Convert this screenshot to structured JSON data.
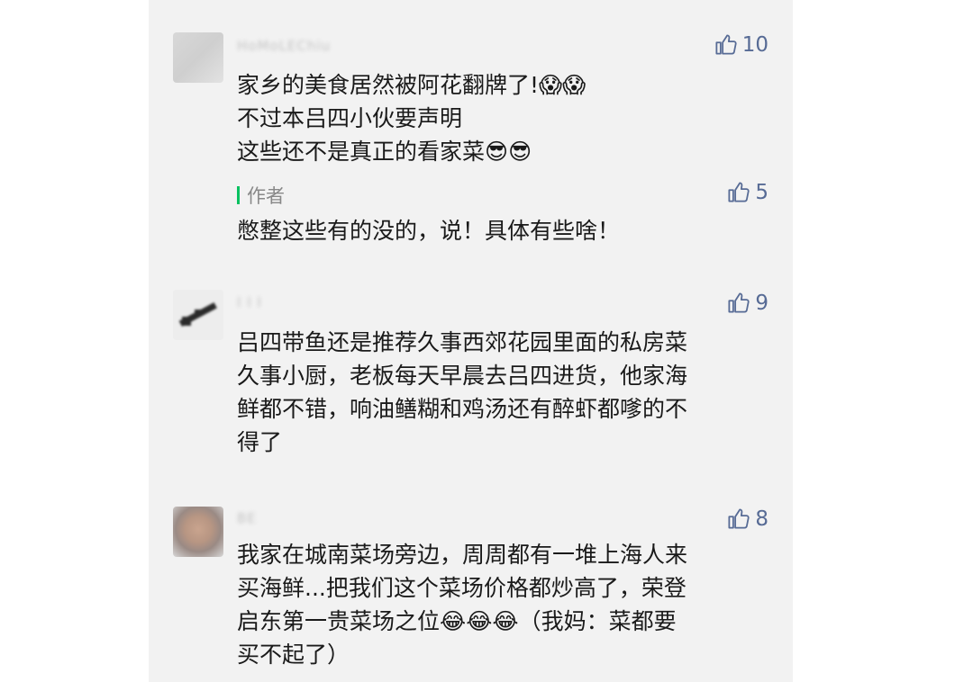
{
  "comments": [
    {
      "nickname": "HoMoLEChiu",
      "likes": "10",
      "lines": [
        "家乡的美食居然被阿花翻牌了!😱😱",
        "不过本吕四小伙要声明",
        "这些还不是真正的看家菜😎😎"
      ],
      "reply": {
        "tag": "作者",
        "likes": "5",
        "text": "憋整这些有的没的，说！具体有些啥！"
      }
    },
    {
      "nickname": "I I I",
      "likes": "9",
      "lines": [
        "吕四带鱼还是推荐久事西郊花园里面的私房菜",
        "久事小厨，老板每天早晨去吕四进货，他家海",
        "鲜都不错，响油鳝糊和鸡汤还有醉虾都嗲的不",
        "得了"
      ]
    },
    {
      "nickname": "BE",
      "likes": "8",
      "lines": [
        "我家在城南菜场旁边，周周都有一堆上海人来",
        "买海鲜...把我们这个菜场价格都炒高了，荣登",
        "启东第一贵菜场之位😂😂😂（我妈：菜都要",
        "买不起了）"
      ]
    }
  ],
  "icons": {
    "like": "thumbs-up-icon"
  },
  "colors": {
    "like": "#576b95",
    "author_bar": "#07c160",
    "panel_bg": "#f2f2f2"
  }
}
